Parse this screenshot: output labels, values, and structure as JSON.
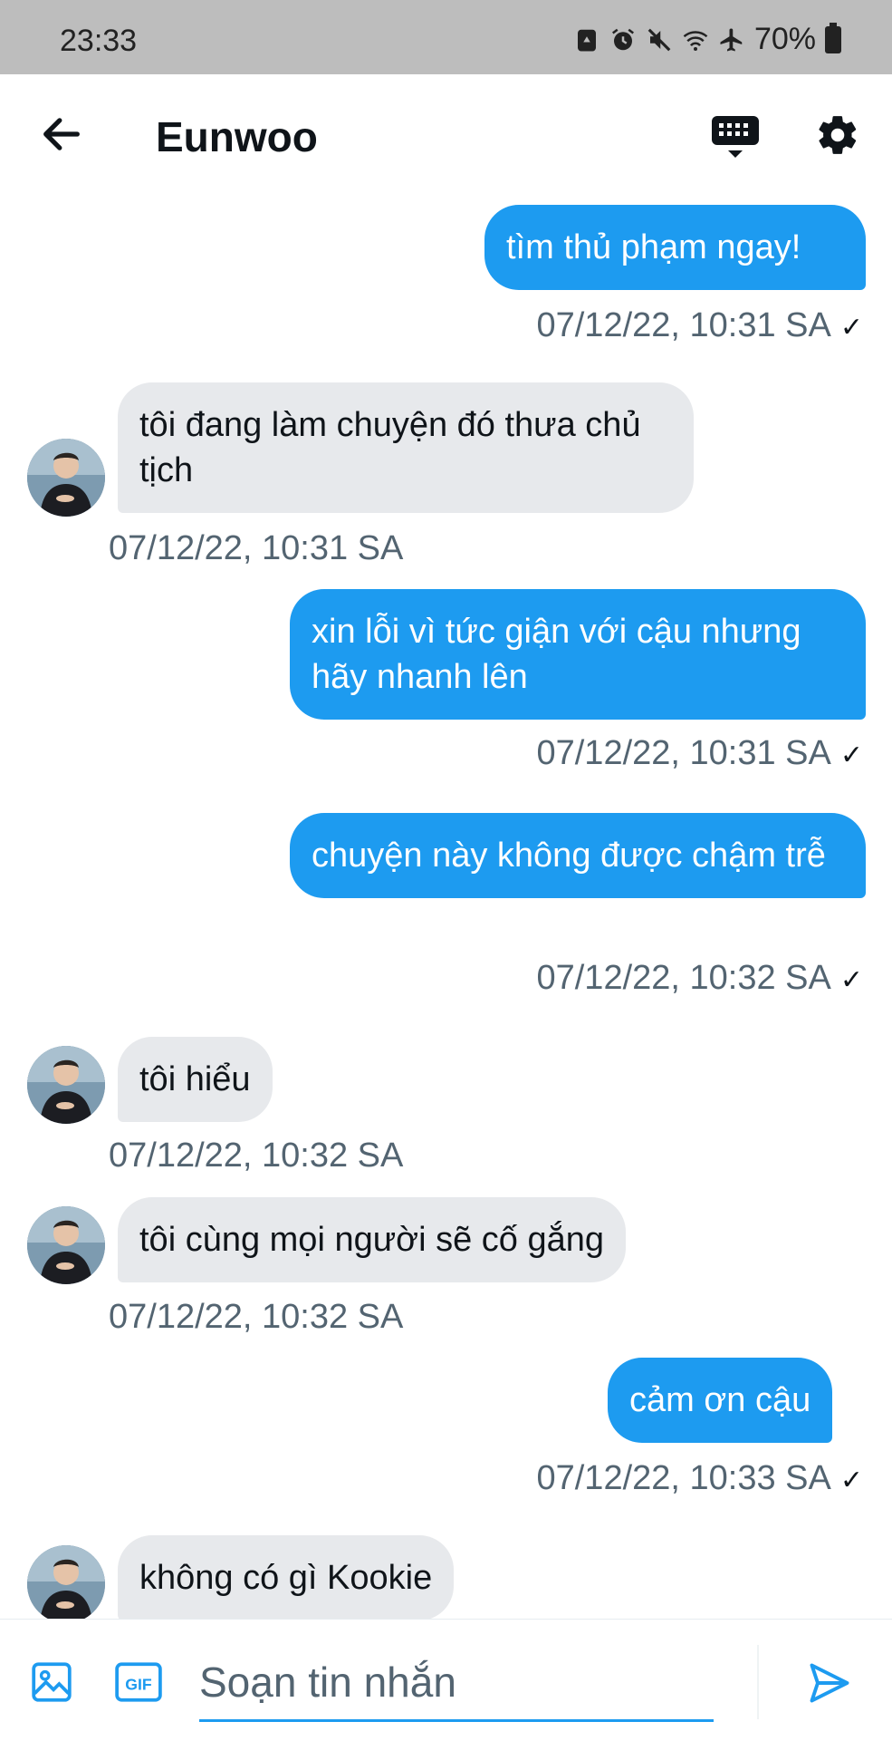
{
  "status_bar": {
    "time": "23:33",
    "battery": "70%"
  },
  "header": {
    "contact_name": "Eunwoo"
  },
  "messages": [
    {
      "dir": "out",
      "text": "tìm thủ phạm ngay!",
      "time": "07/12/22, 10:31 SA",
      "read": true
    },
    {
      "dir": "in",
      "text": "tôi đang làm chuyện đó thưa chủ tịch",
      "time": "07/12/22, 10:31 SA"
    },
    {
      "dir": "out",
      "text": "xin lỗi vì tức giận với cậu nhưng hãy nhanh lên",
      "time": "07/12/22, 10:31 SA",
      "read": true
    },
    {
      "dir": "out",
      "text": "chuyện này không được chậm trễ",
      "time": "07/12/22, 10:32 SA",
      "read": true
    },
    {
      "dir": "in",
      "text": "tôi hiểu",
      "time": "07/12/22, 10:32 SA"
    },
    {
      "dir": "in",
      "text": "tôi cùng mọi người sẽ cố gắng",
      "time": "07/12/22, 10:32 SA"
    },
    {
      "dir": "out",
      "text": "cảm ơn cậu",
      "time": "07/12/22, 10:33 SA",
      "read": true
    },
    {
      "dir": "in",
      "text": "không có gì Kookie",
      "time": ""
    }
  ],
  "composer": {
    "placeholder": "Soạn tin nhắn",
    "gif_label": "GIF"
  },
  "colors": {
    "accent": "#1d9bf0",
    "incoming_bubble": "#e7e9ec",
    "muted_text": "#536471"
  }
}
